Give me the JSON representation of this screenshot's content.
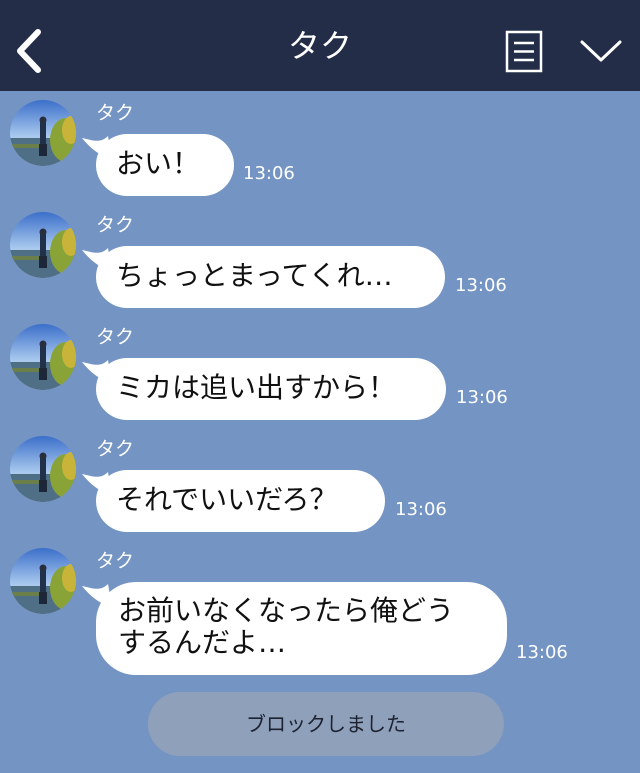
{
  "header": {
    "title": "タク",
    "icons": {
      "back": "chevron-left-icon",
      "menu": "document-menu-icon",
      "toggle": "chevron-down-icon"
    }
  },
  "messages": [
    {
      "sender": "タク",
      "text": "おい！",
      "time": "13:06"
    },
    {
      "sender": "タク",
      "text": "ちょっとまってくれ…",
      "time": "13:06"
    },
    {
      "sender": "タク",
      "text": "ミカは追い出すから！",
      "time": "13:06"
    },
    {
      "sender": "タク",
      "text": "それでいいだろ？",
      "time": "13:06"
    },
    {
      "sender": "タク",
      "lines": [
        "お前いなくなったら俺どう",
        "するんだよ…"
      ],
      "time": "13:06"
    }
  ],
  "system_notice": "ブロックしました",
  "colors": {
    "header_bg": "#232d47",
    "chat_bg": "#7494c4",
    "bubble_bg": "#ffffff",
    "notice_bg": "#8fa0bb"
  }
}
